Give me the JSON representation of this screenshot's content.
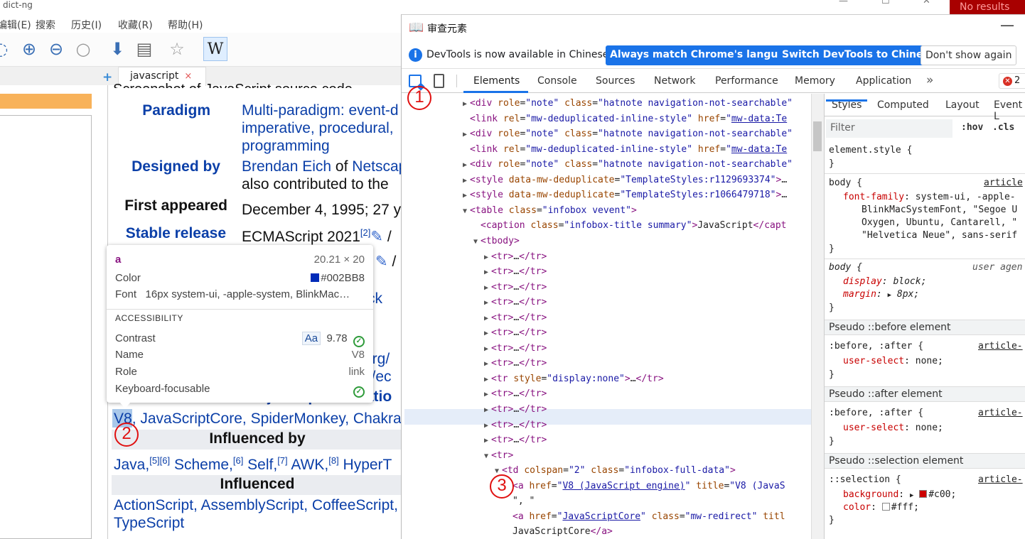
{
  "bg": {
    "title_fragment": "dict-ng",
    "no_results": "No results",
    "menu": [
      "编辑(E)",
      "搜索",
      "历史(I)",
      "收藏(R)",
      "帮助(H)"
    ],
    "toolbar_wiki": "W",
    "tab_label": "javascript",
    "tab_close": "×",
    "tab_plus": "+"
  },
  "infobox": {
    "caption_fragment": "Screenshot of JavaScript source code",
    "paradigm_label": "Paradigm",
    "paradigm_l1": "Multi-paradigm: event-d",
    "paradigm_l2": "imperative, procedural, ",
    "paradigm_l3": "programming",
    "designed_label": "Designed by",
    "designed_l1a": "Brendan Eich",
    "designed_l1b": " of ",
    "designed_l1c": "Netscap",
    "designed_l2": "also contributed to the",
    "first_label": "First appeared",
    "first_value": "December 4, 1995; 27 y",
    "stable_label": "Stable release",
    "stable_value": "ECMAScript 2021",
    "stable_sup": "[2]",
    "stable_tail": " / ",
    "row2_tail": " / ",
    "frag_ck": "ck",
    "frag_org": "org/",
    "frag_sec": "s/ec",
    "major_impl": "Major implementatio",
    "impl_v8": "V8",
    "impl_rest": ", JavaScriptCore, SpiderMonkey, Chakra",
    "influenced_by": "Influenced by",
    "infl_by_list": "Java,[5][6] Scheme,[6] Self,[7] AWK,[8] HyperT",
    "influenced": "Influenced",
    "infl_l1": "ActionScript, AssemblyScript, CoffeeScript,",
    "infl_l2": "TypeScript"
  },
  "tooltip": {
    "tag": "a",
    "size": "20.21 × 20",
    "color_label": "Color",
    "color_value": "#002BB8",
    "color_hex": "#002BB8",
    "font_label": "Font",
    "font_value": "16px system-ui, -apple-system, BlinkMac…",
    "section": "ACCESSIBILITY",
    "contrast_label": "Contrast",
    "contrast_aa": "Aa",
    "contrast_value": "9.78",
    "name_label": "Name",
    "name_value": "V8",
    "role_label": "Role",
    "role_value": "link",
    "kbd_label": "Keyboard-focusable"
  },
  "markers": [
    "1",
    "2",
    "3"
  ],
  "devtools": {
    "title": "审查元素",
    "info_msg": "DevTools is now available in Chinese!",
    "btn_match": "Always match Chrome's language",
    "btn_switch": "Switch DevTools to Chinese",
    "btn_dont": "Don't show again",
    "tabs": [
      "Elements",
      "Console",
      "Sources",
      "Network",
      "Performance",
      "Memory",
      "Application"
    ],
    "more": "»",
    "errors": "2"
  },
  "tree": [
    {
      "ind": 0,
      "tri": "▶",
      "html": "<span class='tg'>&lt;div</span> <span class='at'>role</span>=<span class='av'>\"note\"</span> <span class='at'>class</span>=<span class='av'>\"hatnote navigation-not-searchable\"</span>"
    },
    {
      "ind": 0,
      "tri": "",
      "html": "<span class='tg'>&lt;link</span> <span class='at'>rel</span>=<span class='av'>\"mw-deduplicated-inline-style\"</span> <span class='at'>href</span>=<span class='av'>\"</span><span class='ul'>mw-data:Te</span>"
    },
    {
      "ind": 0,
      "tri": "▶",
      "html": "<span class='tg'>&lt;div</span> <span class='at'>role</span>=<span class='av'>\"note\"</span> <span class='at'>class</span>=<span class='av'>\"hatnote navigation-not-searchable\"</span>"
    },
    {
      "ind": 0,
      "tri": "",
      "html": "<span class='tg'>&lt;link</span> <span class='at'>rel</span>=<span class='av'>\"mw-deduplicated-inline-style\"</span> <span class='at'>href</span>=<span class='av'>\"</span><span class='ul'>mw-data:Te</span>"
    },
    {
      "ind": 0,
      "tri": "▶",
      "html": "<span class='tg'>&lt;div</span> <span class='at'>role</span>=<span class='av'>\"note\"</span> <span class='at'>class</span>=<span class='av'>\"hatnote navigation-not-searchable\"</span>"
    },
    {
      "ind": 0,
      "tri": "▶",
      "html": "<span class='tg'>&lt;style</span> <span class='at'>data-mw-deduplicate</span>=<span class='av'>\"TemplateStyles:r1129693374\"</span><span class='tg'>&gt;</span>…"
    },
    {
      "ind": 0,
      "tri": "▶",
      "html": "<span class='tg'>&lt;style</span> <span class='at'>data-mw-deduplicate</span>=<span class='av'>\"TemplateStyles:r1066479718\"</span><span class='tg'>&gt;</span>…"
    },
    {
      "ind": 0,
      "tri": "▼",
      "html": "<span class='tg'>&lt;table</span> <span class='at'>class</span>=<span class='av'>\"infobox vevent\"</span><span class='tg'>&gt;</span>"
    },
    {
      "ind": 1,
      "tri": "",
      "html": "<span class='tg'>&lt;caption</span> <span class='at'>class</span>=<span class='av'>\"infobox-title summary\"</span><span class='tg'>&gt;</span><span class='tx'>JavaScript</span><span class='tg'>&lt;/capt</span>"
    },
    {
      "ind": 1,
      "tri": "▼",
      "html": "<span class='tg'>&lt;tbody&gt;</span>"
    },
    {
      "ind": 2,
      "tri": "▶",
      "html": "<span class='tg'>&lt;tr&gt;</span>…<span class='tg'>&lt;/tr&gt;</span>"
    },
    {
      "ind": 2,
      "tri": "▶",
      "html": "<span class='tg'>&lt;tr&gt;</span>…<span class='tg'>&lt;/tr&gt;</span>"
    },
    {
      "ind": 2,
      "tri": "▶",
      "html": "<span class='tg'>&lt;tr&gt;</span>…<span class='tg'>&lt;/tr&gt;</span>"
    },
    {
      "ind": 2,
      "tri": "▶",
      "html": "<span class='tg'>&lt;tr&gt;</span>…<span class='tg'>&lt;/tr&gt;</span>"
    },
    {
      "ind": 2,
      "tri": "▶",
      "html": "<span class='tg'>&lt;tr&gt;</span>…<span class='tg'>&lt;/tr&gt;</span>"
    },
    {
      "ind": 2,
      "tri": "▶",
      "html": "<span class='tg'>&lt;tr&gt;</span>…<span class='tg'>&lt;/tr&gt;</span>"
    },
    {
      "ind": 2,
      "tri": "▶",
      "html": "<span class='tg'>&lt;tr&gt;</span>…<span class='tg'>&lt;/tr&gt;</span>"
    },
    {
      "ind": 2,
      "tri": "▶",
      "html": "<span class='tg'>&lt;tr&gt;</span>…<span class='tg'>&lt;/tr&gt;</span>"
    },
    {
      "ind": 2,
      "tri": "▶",
      "html": "<span class='tg'>&lt;tr</span> <span class='at'>style</span>=<span class='av'>\"display:none\"</span><span class='tg'>&gt;</span>…<span class='tg'>&lt;/tr&gt;</span>"
    },
    {
      "ind": 2,
      "tri": "▶",
      "html": "<span class='tg'>&lt;tr&gt;</span>…<span class='tg'>&lt;/tr&gt;</span>"
    },
    {
      "ind": 2,
      "tri": "▶",
      "html": "<span class='tg'>&lt;tr&gt;</span>…<span class='tg'>&lt;/tr&gt;</span>"
    },
    {
      "ind": 2,
      "tri": "▶",
      "html": "<span class='tg'>&lt;tr&gt;</span>…<span class='tg'>&lt;/tr&gt;</span>"
    },
    {
      "ind": 2,
      "tri": "▶",
      "html": "<span class='tg'>&lt;tr&gt;</span>…<span class='tg'>&lt;/tr&gt;</span>"
    },
    {
      "ind": 2,
      "tri": "▼",
      "html": "<span class='tg'>&lt;tr&gt;</span>"
    },
    {
      "ind": 3,
      "tri": "▼",
      "html": "<span class='tg'>&lt;td</span> <span class='at'>colspan</span>=<span class='av'>\"2\"</span> <span class='at'>class</span>=<span class='av'>\"infobox-full-data\"</span><span class='tg'>&gt;</span>"
    },
    {
      "ind": 4,
      "tri": "",
      "html": "<span class='tg'>&lt;a</span> <span class='at'>href</span>=<span class='av'>\"</span><span class='ul'>V8 (JavaScript engine)</span><span class='av'>\"</span> <span class='at'>title</span>=<span class='av'>\"V8 (JavaS</span>"
    },
    {
      "ind": 4,
      "tri": "",
      "html": "<span class='tx'>\", \"</span>"
    },
    {
      "ind": 4,
      "tri": "",
      "html": "<span class='tg'>&lt;a</span> <span class='at'>href</span>=<span class='av'>\"</span><span class='ul'>JavaScriptCore</span><span class='av'>\"</span> <span class='at'>class</span>=<span class='av'>\"mw-redirect\"</span> <span class='at'>titl</span>"
    },
    {
      "ind": 4,
      "tri": "",
      "html": "<span class='tx'>JavaScriptCore</span><span class='tg'>&lt;/a&gt;</span>"
    }
  ],
  "styles": {
    "tabs": [
      "Styles",
      "Computed",
      "Layout",
      "Event L"
    ],
    "filter_placeholder": "Filter",
    "hov": ":hov",
    "cls": ".cls",
    "element_style": "element.style {",
    "close": "}",
    "body_sel": "body {",
    "body_src": "article",
    "ff_prop": "font-family",
    "ff_v1": "system-ui, -apple-",
    "ff_v2": "BlinkMacSystemFont, \"Segoe U",
    "ff_v3": "Oxygen, Ubuntu, Cantarell, \"",
    "ff_v4": "\"Helvetica Neue\", sans-serif",
    "ua_sel": "body {",
    "ua_src": "user agen",
    "disp_prop": "display",
    "disp_val": "block;",
    "margin_prop": "margin",
    "margin_val": "8px;",
    "pseudo_before": "Pseudo ::before element",
    "pseudo_after": "Pseudo ::after element",
    "pseudo_sel": "Pseudo ::selection element",
    "ba_sel": ":before, :after {",
    "ba_src": "article-",
    "us_prop": "user-select",
    "us_val": "none;",
    "sel_sel": "::selection {",
    "bg_prop": "background",
    "bg_val": "#c00;",
    "bg_color": "#cc0000",
    "col_prop": "color",
    "col_val": "#fff;",
    "col_color": "#ffffff"
  }
}
